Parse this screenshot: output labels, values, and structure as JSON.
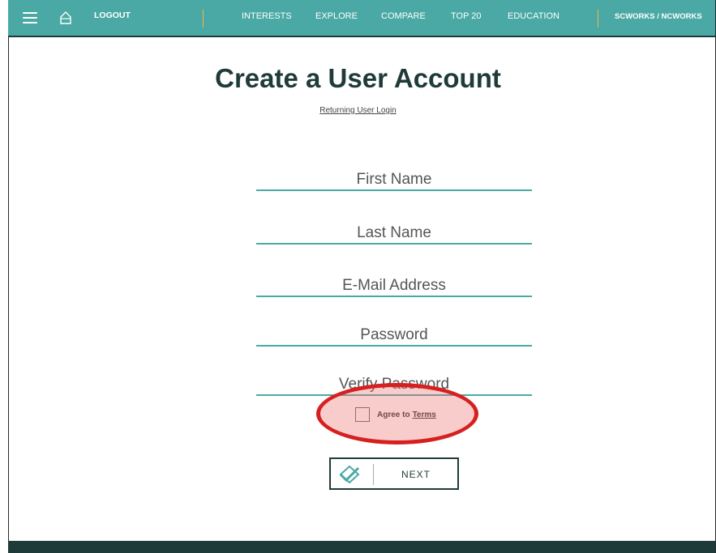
{
  "nav": {
    "logout": "LOGOUT",
    "items": [
      "INTERESTS",
      "EXPLORE",
      "COMPARE",
      "TOP 20",
      "EDUCATION"
    ],
    "scworks": "SCWORKS / NCWORKS"
  },
  "page": {
    "title": "Create a User Account",
    "returning_login": "Returning User Login"
  },
  "form": {
    "first_name_placeholder": "First Name",
    "last_name_placeholder": "Last Name",
    "email_placeholder": "E-Mail Address",
    "password_placeholder": "Password",
    "verify_password_placeholder": "Verify Password",
    "agree_text": "Agree to",
    "terms_link": "Terms",
    "next_label": "NEXT"
  },
  "colors": {
    "accent": "#4aa9a4",
    "dark": "#1f3b39",
    "highlight": "#d62020"
  }
}
